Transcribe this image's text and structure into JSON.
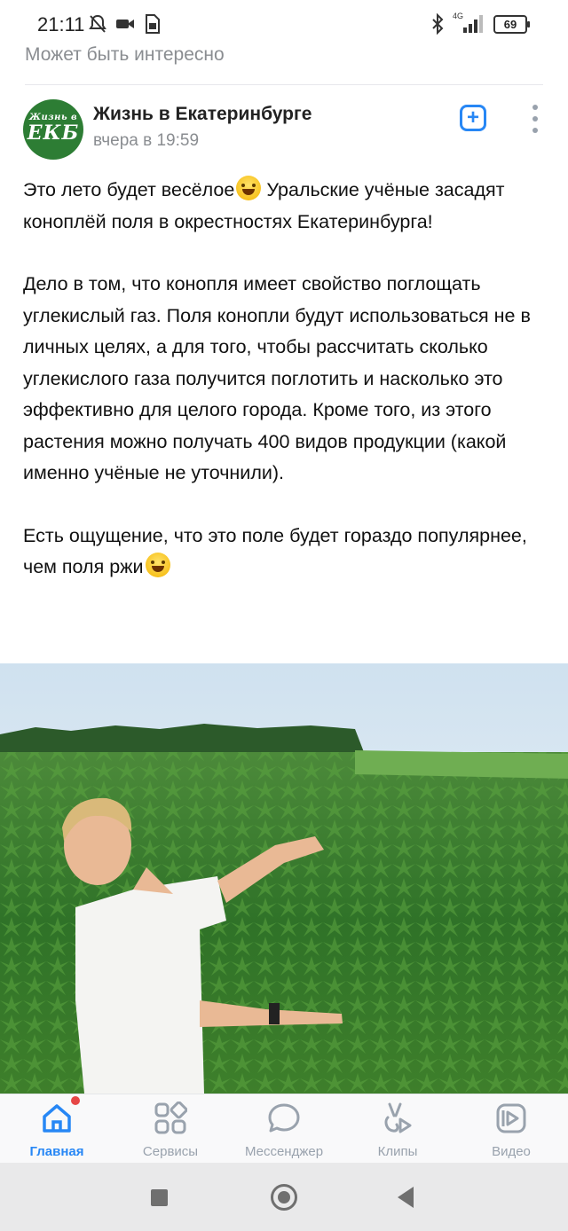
{
  "status_bar": {
    "time": "21:11",
    "network": "4G",
    "battery": "69"
  },
  "feed": {
    "section_title": "Может быть интересно"
  },
  "post": {
    "author": "Жизнь в Екатеринбурге",
    "avatar_text_line1": "Жизнь в",
    "avatar_text_line2": "ЕКБ",
    "time": "вчера в 19:59",
    "add_label": "+",
    "paragraph1": "Это лето будет весёлое",
    "paragraph1_rest": " Уральские учёные засадят коноплёй поля в окрестностях Екатеринбурга!",
    "paragraph2": "Дело в том, что конопля имеет свойство поглощать углекислый газ. Поля конопли будут использоваться не в личных целях, а для того, чтобы рассчитать сколько углекислого газа получится поглотить и насколько это эффективно для целого города. Кроме того, из этого растения можно получать 400 видов продукции (какой именно учёные не уточнили).",
    "paragraph3": "Есть ощущение, что это поле будет гораздо популярнее, чем поля ржи"
  },
  "bottom_nav": {
    "items": [
      {
        "label": "Главная",
        "icon": "home-icon",
        "active": true
      },
      {
        "label": "Сервисы",
        "icon": "services-icon",
        "active": false
      },
      {
        "label": "Мессенджер",
        "icon": "messenger-icon",
        "active": false
      },
      {
        "label": "Клипы",
        "icon": "clips-icon",
        "active": false
      },
      {
        "label": "Видео",
        "icon": "video-icon",
        "active": false
      }
    ]
  },
  "colors": {
    "accent": "#2787f5",
    "secondary_text": "#8a8d91",
    "notification": "#e64646"
  }
}
